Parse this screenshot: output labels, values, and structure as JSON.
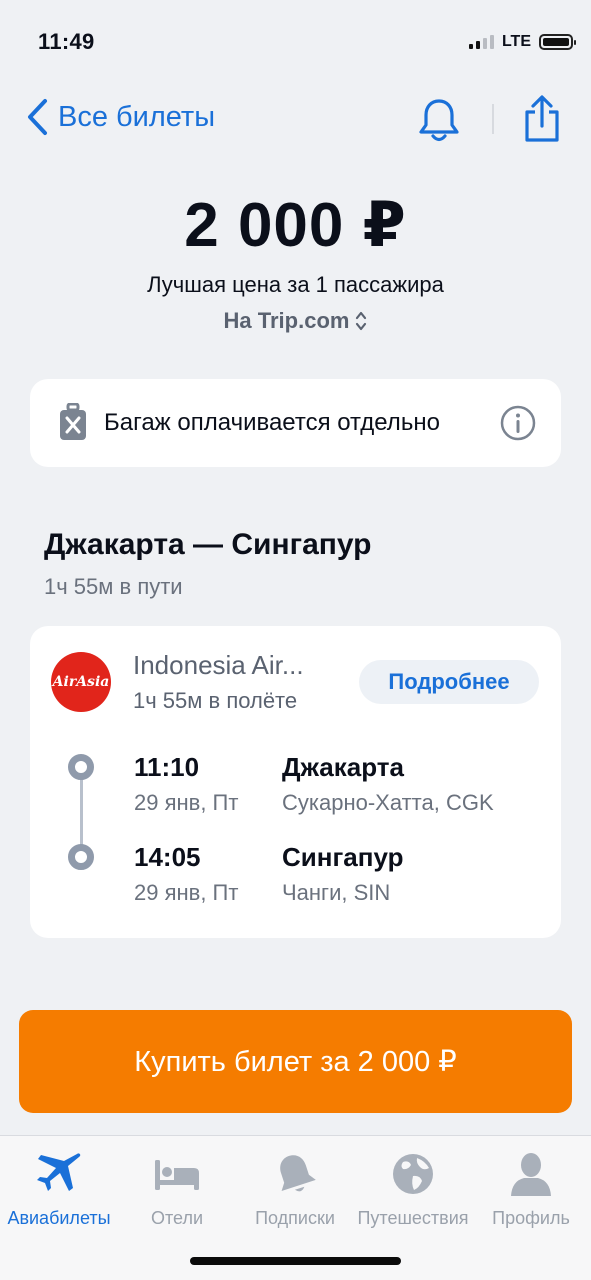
{
  "status_bar": {
    "time": "11:49",
    "network": "LTE"
  },
  "nav": {
    "back_label": "Все билеты"
  },
  "price": {
    "amount": "2 000 ₽",
    "subtitle": "Лучшая цена за 1 пассажира",
    "source": "На Trip.com"
  },
  "baggage": {
    "text": "Багаж оплачивается отдельно"
  },
  "route": {
    "title": "Джакарта — Сингапур",
    "duration": "1ч 55м в пути"
  },
  "flight": {
    "airline_logo_text": "AirAsia",
    "airline": "Indonesia Air...",
    "duration": "1ч 55м в полёте",
    "details_label": "Подробнее",
    "departure": {
      "time": "11:10",
      "date": "29 янв, Пт",
      "city": "Джакарта",
      "airport": "Сукарно-Хатта, CGK"
    },
    "arrival": {
      "time": "14:05",
      "date": "29 янв, Пт",
      "city": "Сингапур",
      "airport": "Чанги, SIN"
    }
  },
  "buy_button": {
    "label": "Купить билет за 2 000 ₽"
  },
  "tabs": [
    {
      "label": "Авиабилеты",
      "icon": "plane-icon",
      "active": true
    },
    {
      "label": "Отели",
      "icon": "bed-icon",
      "active": false
    },
    {
      "label": "Подписки",
      "icon": "bell-icon",
      "active": false
    },
    {
      "label": "Путешествия",
      "icon": "globe-icon",
      "active": false
    },
    {
      "label": "Профиль",
      "icon": "person-icon",
      "active": false
    }
  ],
  "colors": {
    "accent": "#1a70d8",
    "buy": "#f57c00",
    "airasia": "#e1251b",
    "background": "#eff1f4"
  }
}
